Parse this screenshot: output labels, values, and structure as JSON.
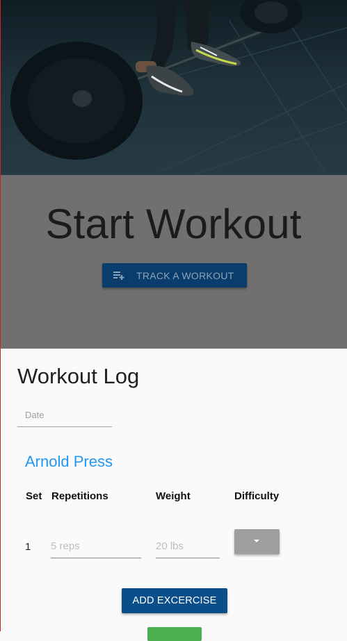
{
  "hero": {
    "title": "Start Workout",
    "track_button_label": "TRACK A WORKOUT",
    "track_button_icon": "playlist-add-icon",
    "accent_color": "#0a3d6b"
  },
  "log": {
    "title": "Workout Log",
    "date_placeholder": "Date",
    "exercise": {
      "name": "Arnold Press",
      "columns": [
        "Set",
        "Repetitions",
        "Weight",
        "Difficulty"
      ],
      "sets": [
        {
          "set": "1",
          "reps_placeholder": "5 reps",
          "weight_placeholder": "20 lbs"
        }
      ],
      "difficulty_icon": "caret-down-icon"
    },
    "add_button_label": "ADD EXCERCISE",
    "colors": {
      "exercise_name": "#2196f3",
      "primary_button": "#0b4f8a",
      "secondary_button": "#4caf50"
    }
  }
}
